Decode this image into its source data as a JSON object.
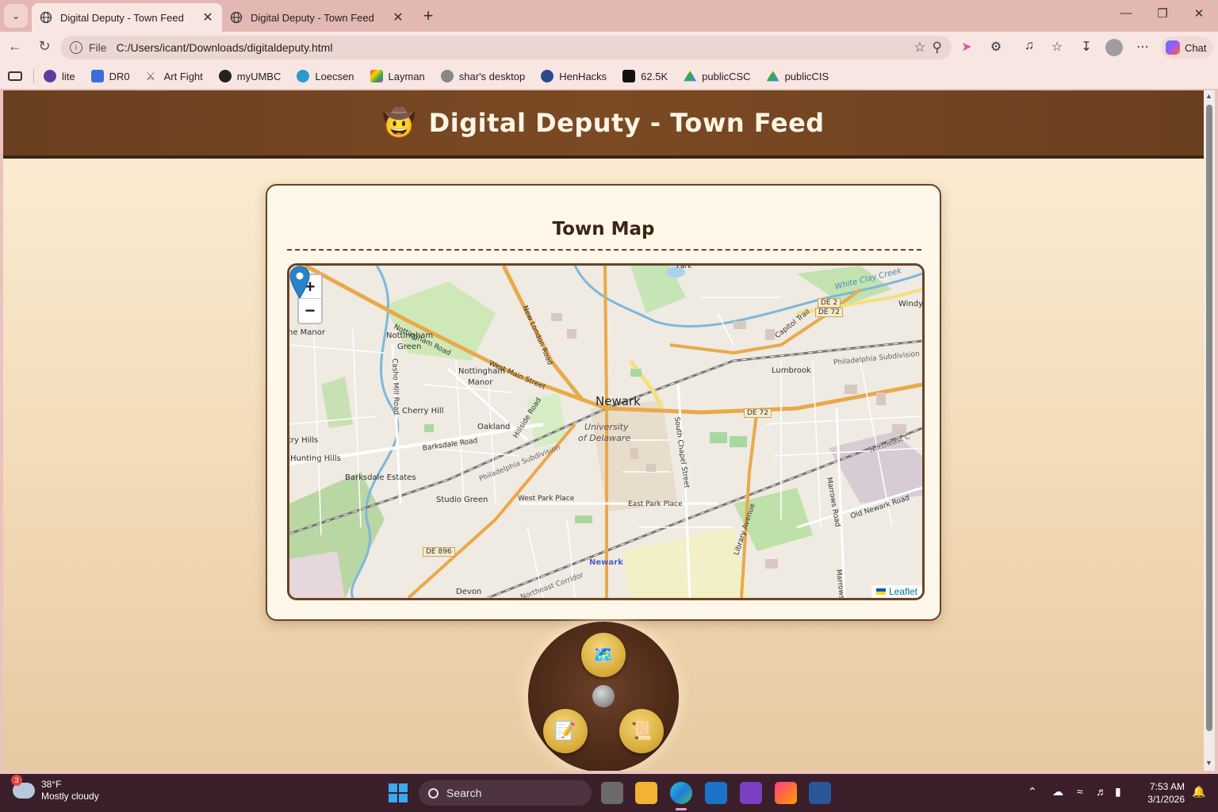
{
  "browser": {
    "tabs": [
      {
        "title": "Digital Deputy - Town Feed",
        "active": true
      },
      {
        "title": "Digital Deputy - Town Feed",
        "active": false
      }
    ],
    "address": {
      "scheme_label": "File",
      "url": "C:/Users/icant/Downloads/digitaldeputy.html"
    },
    "chat_label": "Chat",
    "bookmarks": [
      {
        "label": "lite",
        "icon": "person-icon",
        "color": "#5b3fa0"
      },
      {
        "label": "DR0",
        "icon": "doc-icon",
        "color": "#3b6fd8"
      },
      {
        "label": "Art Fight",
        "icon": "swords-icon",
        "color": "#4a5560"
      },
      {
        "label": "myUMBC",
        "icon": "paw-icon",
        "color": "#222222"
      },
      {
        "label": "Loecsen",
        "icon": "sun-icon",
        "color": "#2a9bd0"
      },
      {
        "label": "Layman",
        "icon": "star-icon",
        "color": "#c33fd0"
      },
      {
        "label": "shar's desktop",
        "icon": "dragon-icon",
        "color": "#888888"
      },
      {
        "label": "HenHacks",
        "icon": "globe-icon",
        "color": "#2b4a8a"
      },
      {
        "label": "62.5K",
        "icon": "tiktok-icon",
        "color": "#111111"
      },
      {
        "label": "publicCSC",
        "icon": "drive-icon",
        "color": "#34a853"
      },
      {
        "label": "publicCIS",
        "icon": "drive-icon",
        "color": "#34a853"
      }
    ]
  },
  "page": {
    "header_emoji": "🤠",
    "title": "Digital Deputy - Town Feed",
    "card_title": "Town Map",
    "map": {
      "zoom_in": "+",
      "zoom_out": "−",
      "attribution": "Leaflet",
      "labels": [
        {
          "text": "Newark",
          "kind": "city"
        },
        {
          "text": "University",
          "kind": "campus"
        },
        {
          "text": "of Delaware",
          "kind": "campus"
        },
        {
          "text": "Nottingham Road",
          "kind": "road"
        },
        {
          "text": "Nottingham",
          "kind": "place"
        },
        {
          "text": "Green",
          "kind": "place"
        },
        {
          "text": "Nottingham",
          "kind": "place"
        },
        {
          "text": "Manor",
          "kind": "place"
        },
        {
          "text": "West Main Street",
          "kind": "road"
        },
        {
          "text": "New London Road",
          "kind": "road"
        },
        {
          "text": "Cherry Hill",
          "kind": "place"
        },
        {
          "text": "Oakland",
          "kind": "place"
        },
        {
          "text": "Hillside Road",
          "kind": "road"
        },
        {
          "text": "Barksdale Road",
          "kind": "road"
        },
        {
          "text": "Barksdale Estates",
          "kind": "place"
        },
        {
          "text": "Hunting Hills",
          "kind": "place"
        },
        {
          "text": "try Hills",
          "kind": "place"
        },
        {
          "text": "ne Manor",
          "kind": "place"
        },
        {
          "text": "Casho Mill Road",
          "kind": "road"
        },
        {
          "text": "Studio Green",
          "kind": "place"
        },
        {
          "text": "West Park Place",
          "kind": "road"
        },
        {
          "text": "East Park Place",
          "kind": "road"
        },
        {
          "text": "South Chapel Street",
          "kind": "road"
        },
        {
          "text": "Library Avenue",
          "kind": "road"
        },
        {
          "text": "Lumbrook",
          "kind": "place"
        },
        {
          "text": "Philadelphia Subdivision",
          "kind": "rail"
        },
        {
          "text": "Philadelphia Subdivision",
          "kind": "rail"
        },
        {
          "text": "Capitol Trail",
          "kind": "road"
        },
        {
          "text": "White Clay Creek",
          "kind": "water"
        },
        {
          "text": "Windy",
          "kind": "place"
        },
        {
          "text": "DE 2",
          "kind": "shield"
        },
        {
          "text": "DE 72",
          "kind": "shield"
        },
        {
          "text": "DE 72",
          "kind": "shield"
        },
        {
          "text": "DE 896",
          "kind": "shield"
        },
        {
          "text": "Marrows Road",
          "kind": "road"
        },
        {
          "text": "Old Newark Road",
          "kind": "road"
        },
        {
          "text": "Northeast C",
          "kind": "rail"
        },
        {
          "text": "Northeast Corridor",
          "kind": "rail"
        },
        {
          "text": "Newark",
          "kind": "station"
        },
        {
          "text": "Devon",
          "kind": "place"
        },
        {
          "text": "Park",
          "kind": "place"
        },
        {
          "text": "Marrows",
          "kind": "road"
        }
      ]
    },
    "radial_menu": [
      {
        "label": "map",
        "emoji": "🗺️"
      },
      {
        "label": "write",
        "emoji": "📝"
      },
      {
        "label": "scroll",
        "emoji": "📜"
      }
    ]
  },
  "taskbar": {
    "weather_badge": "3",
    "temperature": "38°F",
    "condition": "Mostly cloudy",
    "search_label": "Search",
    "time": "7:53 AM",
    "date": "3/1/2026"
  }
}
